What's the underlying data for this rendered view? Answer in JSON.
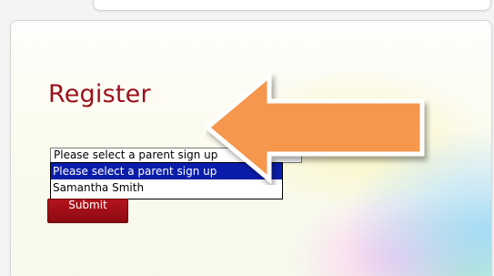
{
  "form": {
    "title": "Register",
    "select": {
      "value": "Please select a parent sign up",
      "options": [
        {
          "label": "Please select a parent sign up",
          "selected": true
        },
        {
          "label": "Samantha Smith",
          "selected": false
        }
      ]
    },
    "submit_label": "Submit"
  },
  "icons": {
    "pointer": "arrow-left-icon"
  },
  "colors": {
    "title": "#9b0f1c",
    "submit_bg": "#9e0f17",
    "selection_bg": "#0a1daa",
    "arrow_fill": "#f5974e"
  }
}
